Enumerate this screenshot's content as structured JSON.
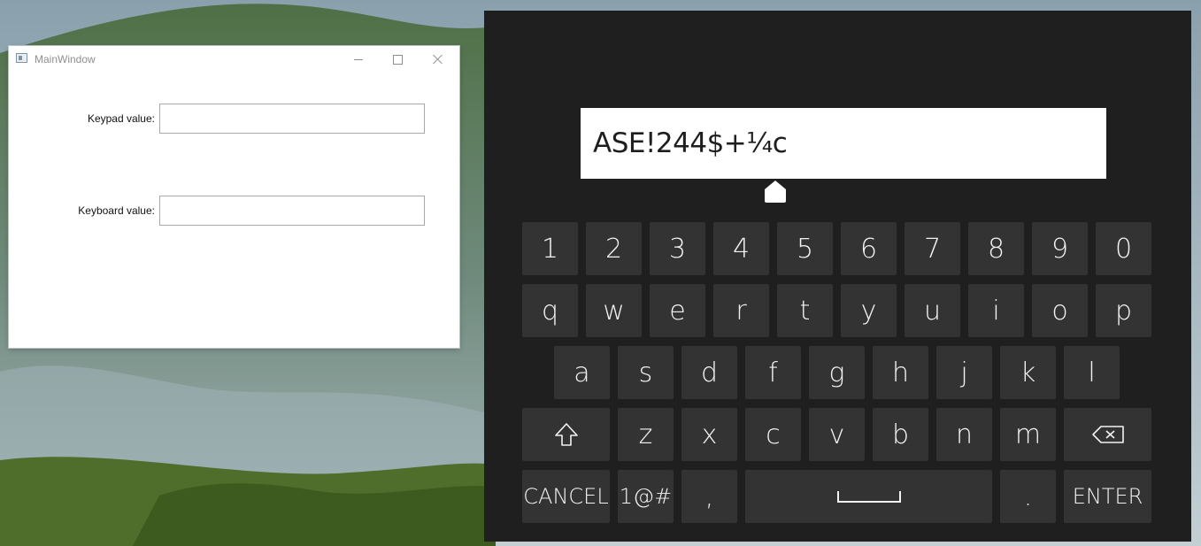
{
  "window": {
    "title": "MainWindow",
    "fields": [
      {
        "label": "Keypad value:",
        "value": ""
      },
      {
        "label": "Keyboard value:",
        "value": ""
      }
    ]
  },
  "keyboard": {
    "display_text": "ASE!244$+¼c",
    "rows": [
      [
        "1",
        "2",
        "3",
        "4",
        "5",
        "6",
        "7",
        "8",
        "9",
        "0"
      ],
      [
        "q",
        "w",
        "e",
        "r",
        "t",
        "y",
        "u",
        "i",
        "o",
        "p"
      ],
      [
        "a",
        "s",
        "d",
        "f",
        "g",
        "h",
        "j",
        "k",
        "l"
      ],
      [
        "z",
        "x",
        "c",
        "v",
        "b",
        "n",
        "m"
      ]
    ],
    "special": {
      "cancel": "CANCEL",
      "symbols": "1@#",
      "comma": ",",
      "period": ".",
      "enter": "ENTER"
    },
    "icons": {
      "shift": "shift-icon",
      "backspace": "backspace-icon",
      "space": "space-bar-icon"
    }
  }
}
